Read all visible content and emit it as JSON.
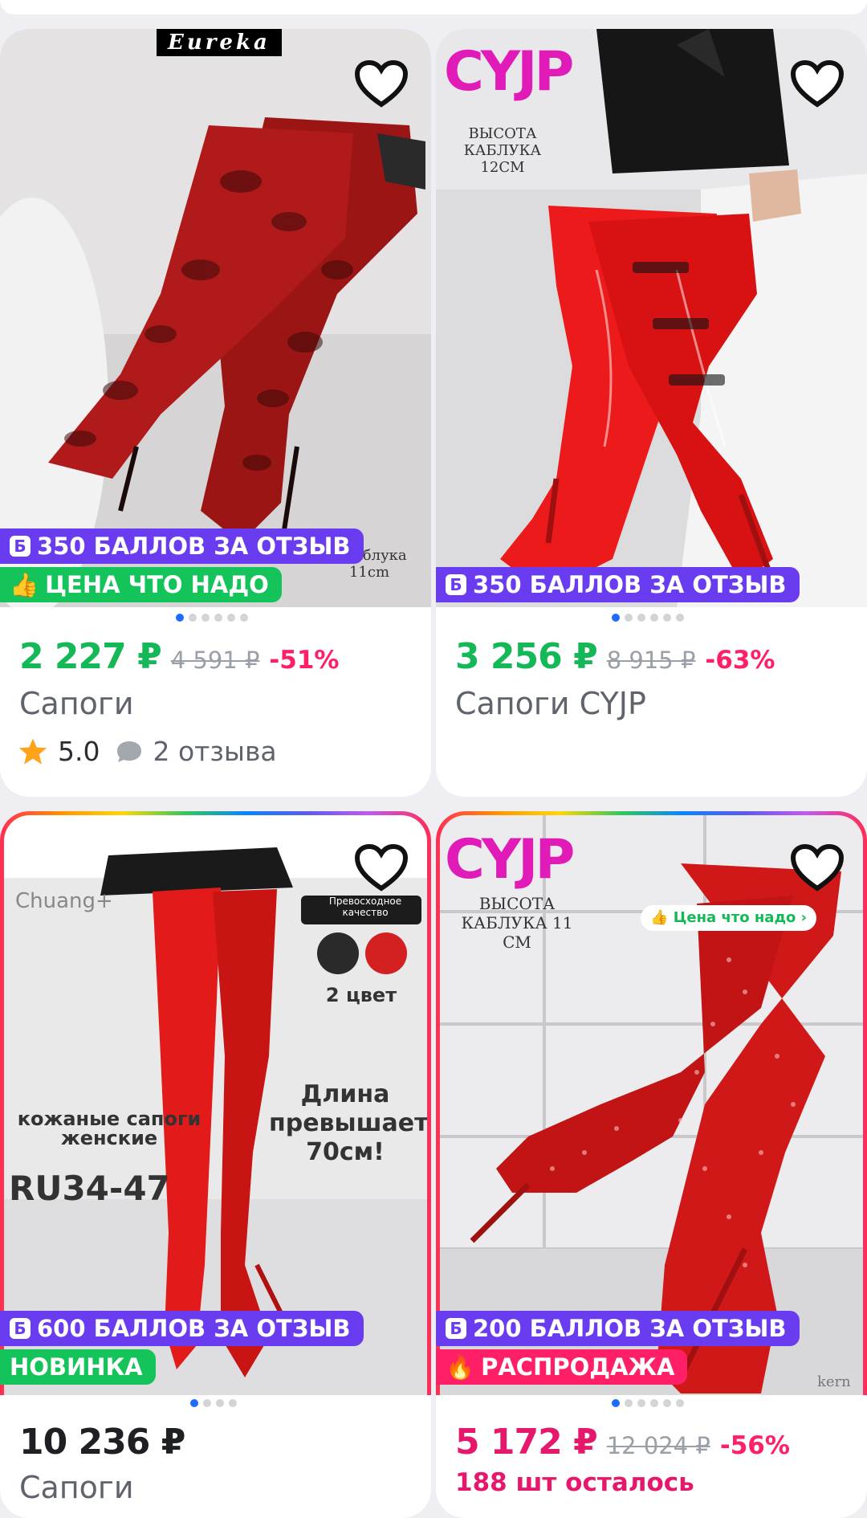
{
  "products": [
    {
      "image_text": {
        "logo": "Eureka",
        "caption": "a каблука 11cm"
      },
      "badges": [
        {
          "text": "350 БАЛЛОВ ЗА ОТЗЫВ",
          "style": "purple"
        },
        {
          "text": "ЦЕНА ЧТО НАДО",
          "style": "green"
        }
      ],
      "price": "2 227 ₽",
      "old_price": "4 591 ₽",
      "discount": "-51%",
      "title": "Сапоги",
      "rating": "5.0",
      "reviews": "2 отзыва",
      "image_count": 6,
      "active_image": 0,
      "favorite": false,
      "price_color": "#14b856"
    },
    {
      "image_text": {
        "logo": "CYJP",
        "caption": "ВЫСОТА КАБЛУКА 12СМ"
      },
      "badges": [
        {
          "text": "350 БАЛЛОВ ЗА ОТЗЫВ",
          "style": "purple"
        }
      ],
      "price": "3 256 ₽",
      "old_price": "8 915 ₽",
      "discount": "-63%",
      "title": "Сапоги CYJP",
      "image_count": 6,
      "active_image": 0,
      "favorite": false,
      "price_color": "#14b856"
    },
    {
      "image_text": {
        "brand": "Chuang+",
        "quality": "Превосходное качество",
        "colors": "2 цвет",
        "desc": "кожаные сапоги женские",
        "size": "RU34-47",
        "length": "Длина превышает 70см!"
      },
      "badges": [
        {
          "text": "600 БАЛЛОВ ЗА ОТЗЫВ",
          "style": "purple"
        },
        {
          "text": "НОВИНКА",
          "style": "green"
        }
      ],
      "price": "10 236 ₽",
      "title": "Сапоги",
      "image_count": 4,
      "active_image": 0,
      "favorite": false,
      "price_color": "#1f2024"
    },
    {
      "image_text": {
        "logo": "CYJP",
        "caption": "ВЫСОТА КАБЛУКА 11 СМ",
        "tag": "Цена что надо",
        "watermark": "kern"
      },
      "badges": [
        {
          "text": "200 БАЛЛОВ ЗА ОТЗЫВ",
          "style": "purple"
        },
        {
          "text": "РАСПРОДАЖА",
          "style": "pink"
        }
      ],
      "price": "5 172 ₽",
      "old_price": "12 024 ₽",
      "discount": "-56%",
      "stock": "188 шт осталось",
      "image_count": 6,
      "active_image": 0,
      "favorite": false,
      "price_color": "#e6186b"
    }
  ]
}
